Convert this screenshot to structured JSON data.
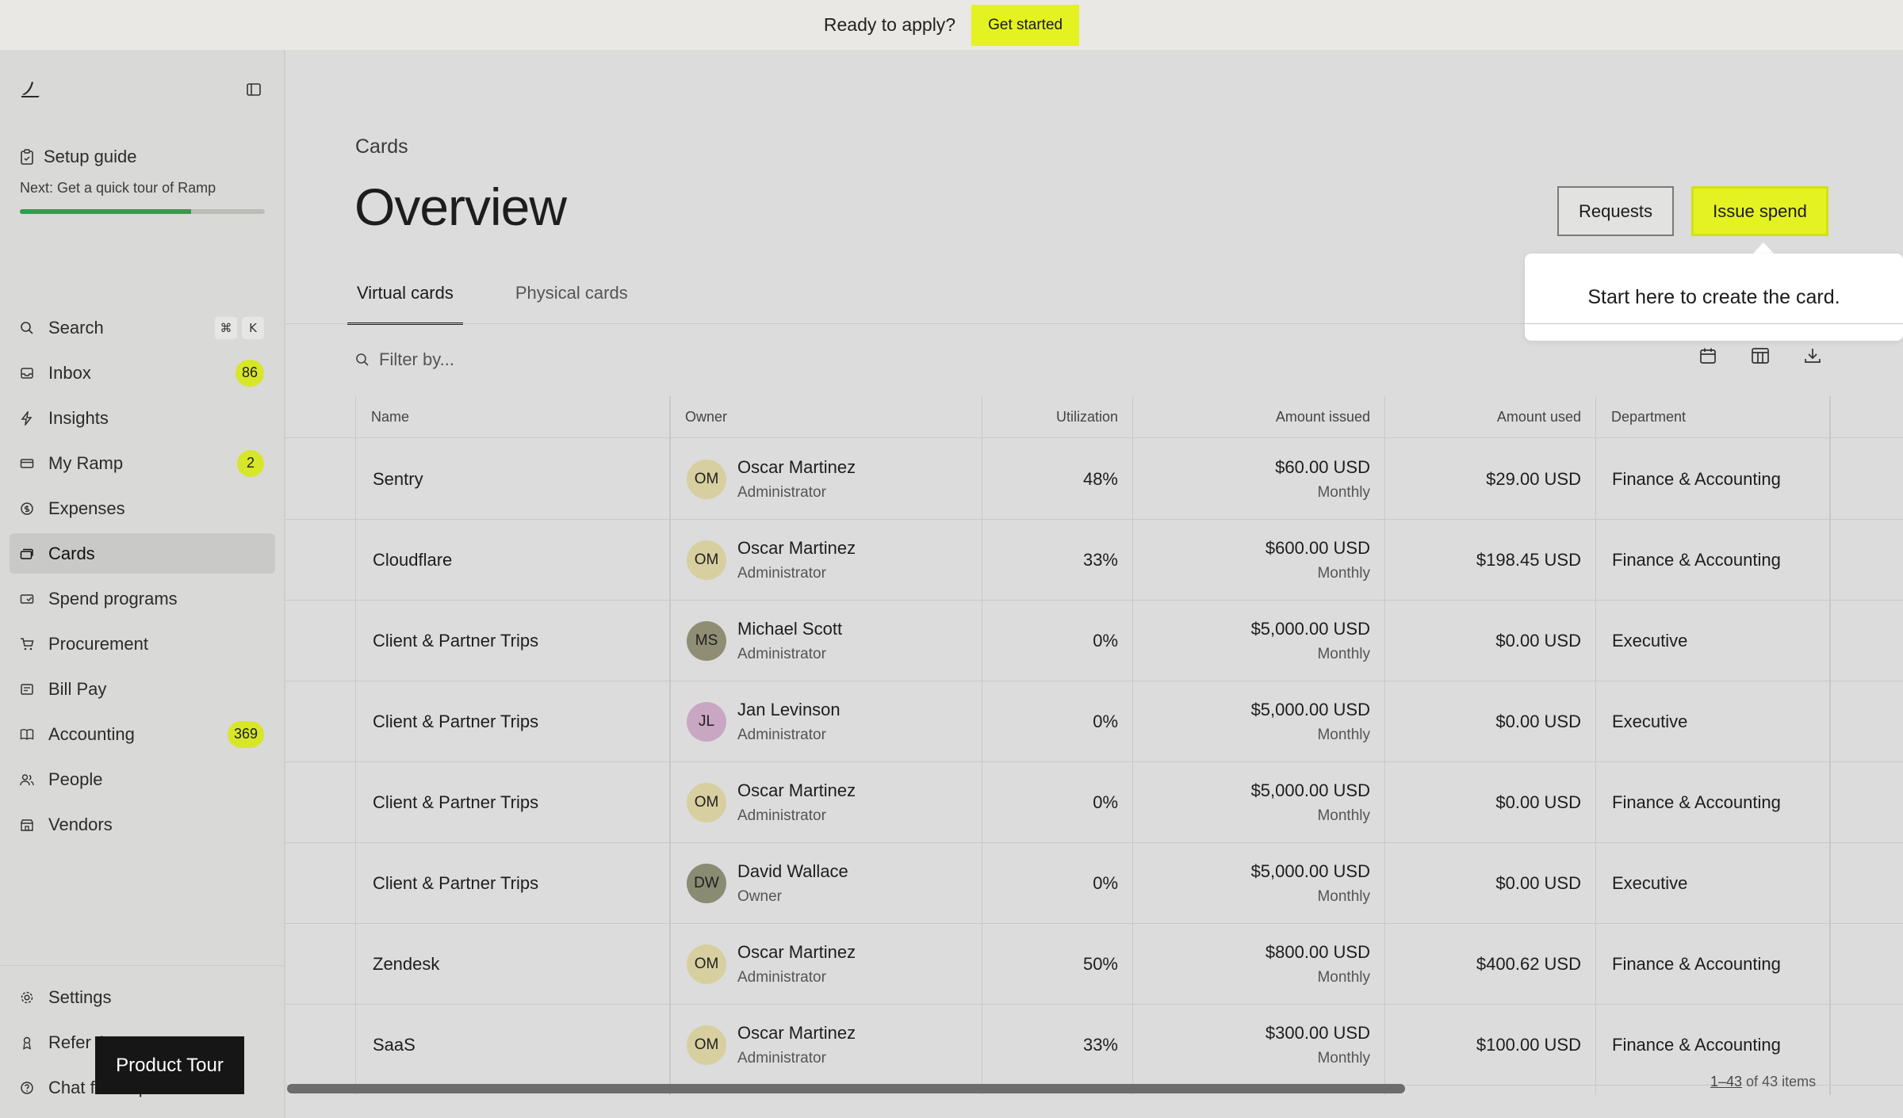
{
  "banner": {
    "text": "Ready to apply?",
    "cta": "Get started"
  },
  "sidebar": {
    "setup": {
      "title": "Setup guide",
      "next": "Next: Get a quick tour of Ramp",
      "progress": 0.7
    },
    "search": {
      "label": "Search",
      "kbd": [
        "⌘",
        "K"
      ]
    },
    "items": [
      {
        "label": "Inbox",
        "badge": "86",
        "icon": "inbox-icon"
      },
      {
        "label": "Insights",
        "badge": "",
        "icon": "lightning-icon"
      },
      {
        "label": "My Ramp",
        "badge": "2",
        "icon": "card-icon"
      },
      {
        "label": "Expenses",
        "badge": "",
        "icon": "dollar-circle-icon"
      },
      {
        "label": "Cards",
        "badge": "",
        "icon": "cards-icon"
      },
      {
        "label": "Spend programs",
        "badge": "",
        "icon": "spend-program-icon"
      },
      {
        "label": "Procurement",
        "badge": "",
        "icon": "cart-icon"
      },
      {
        "label": "Bill Pay",
        "badge": "",
        "icon": "bill-icon"
      },
      {
        "label": "Accounting",
        "badge": "369",
        "icon": "book-icon"
      },
      {
        "label": "People",
        "badge": "",
        "icon": "people-icon"
      },
      {
        "label": "Vendors",
        "badge": "",
        "icon": "store-icon"
      }
    ],
    "bottom": [
      {
        "label": "Settings",
        "icon": "gear-icon"
      },
      {
        "label": "Refer & earn",
        "icon": "gift-icon"
      },
      {
        "label": "Chat for help",
        "icon": "help-icon"
      }
    ],
    "tour": "Product Tour"
  },
  "main": {
    "breadcrumb": "Cards",
    "title": "Overview",
    "requests": "Requests",
    "issue_spend": "Issue spend",
    "popover": "Start here to create the card.",
    "tabs": [
      "Virtual cards",
      "Physical cards"
    ],
    "filter_placeholder": "Filter by...",
    "columns": [
      "Name",
      "Owner",
      "Utilization",
      "Amount issued",
      "Amount used",
      "Department"
    ],
    "rows": [
      {
        "name": "Sentry",
        "initials": "OM",
        "owner": "Oscar Martinez",
        "role": "Administrator",
        "avatar": "#d7cfa0",
        "util": "48%",
        "issued": "$60.00 USD",
        "period": "Monthly",
        "used": "$29.00 USD",
        "dept": "Finance & Accounting"
      },
      {
        "name": "Cloudflare",
        "initials": "OM",
        "owner": "Oscar Martinez",
        "role": "Administrator",
        "avatar": "#d7cfa0",
        "util": "33%",
        "issued": "$600.00 USD",
        "period": "Monthly",
        "used": "$198.45 USD",
        "dept": "Finance & Accounting"
      },
      {
        "name": "Client & Partner Trips",
        "initials": "MS",
        "owner": "Michael Scott",
        "role": "Administrator",
        "avatar": "#8f8e74",
        "util": "0%",
        "issued": "$5,000.00 USD",
        "period": "Monthly",
        "used": "$0.00 USD",
        "dept": "Executive"
      },
      {
        "name": "Client & Partner Trips",
        "initials": "JL",
        "owner": "Jan Levinson",
        "role": "Administrator",
        "avatar": "#c9a6c2",
        "util": "0%",
        "issued": "$5,000.00 USD",
        "period": "Monthly",
        "used": "$0.00 USD",
        "dept": "Executive"
      },
      {
        "name": "Client & Partner Trips",
        "initials": "OM",
        "owner": "Oscar Martinez",
        "role": "Administrator",
        "avatar": "#d7cfa0",
        "util": "0%",
        "issued": "$5,000.00 USD",
        "period": "Monthly",
        "used": "$0.00 USD",
        "dept": "Finance & Accounting"
      },
      {
        "name": "Client & Partner Trips",
        "initials": "DW",
        "owner": "David Wallace",
        "role": "Owner",
        "avatar": "#8a8b73",
        "util": "0%",
        "issued": "$5,000.00 USD",
        "period": "Monthly",
        "used": "$0.00 USD",
        "dept": "Executive"
      },
      {
        "name": "Zendesk",
        "initials": "OM",
        "owner": "Oscar Martinez",
        "role": "Administrator",
        "avatar": "#d7cfa0",
        "util": "50%",
        "issued": "$800.00 USD",
        "period": "Monthly",
        "used": "$400.62 USD",
        "dept": "Finance & Accounting"
      },
      {
        "name": "SaaS",
        "initials": "OM",
        "owner": "Oscar Martinez",
        "role": "Administrator",
        "avatar": "#d7cfa0",
        "util": "33%",
        "issued": "$300.00 USD",
        "period": "Monthly",
        "used": "$100.00 USD",
        "dept": "Finance & Accounting"
      }
    ],
    "pagination": {
      "range": "1–43",
      "rest": " of 43 items"
    }
  }
}
